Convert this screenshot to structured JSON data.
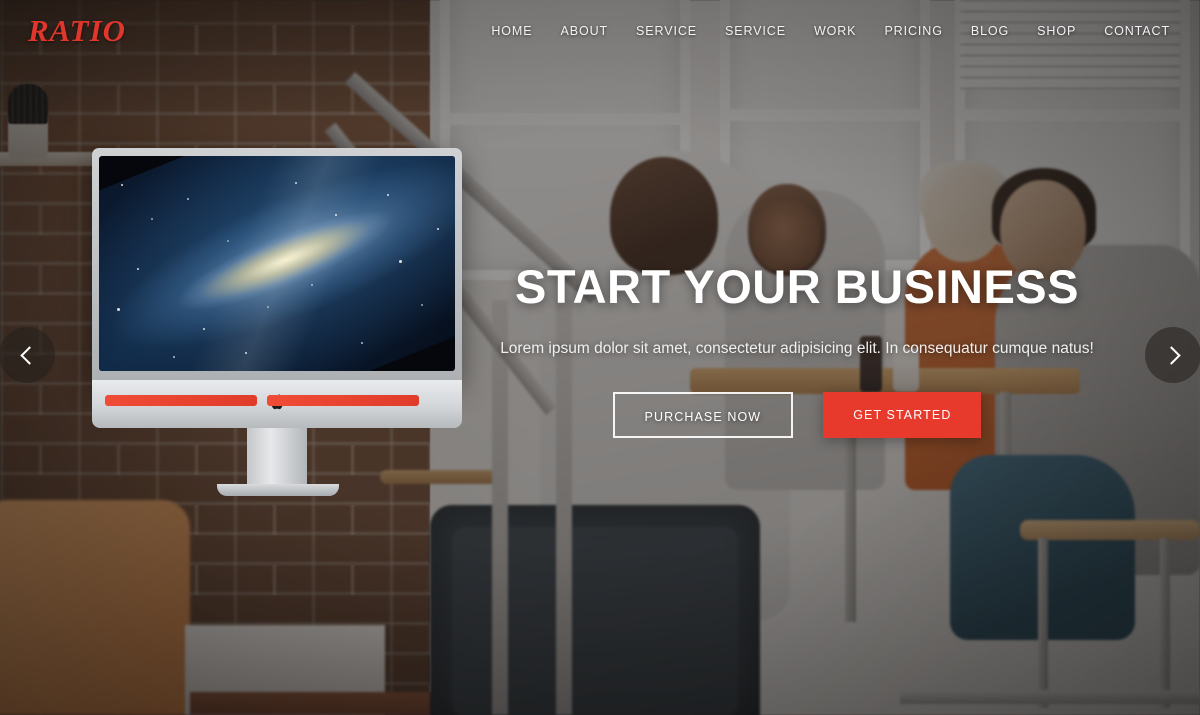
{
  "site": {
    "logo_text": "RATIO",
    "accent_color": "#e8392d",
    "logo_color": "#e0362b"
  },
  "header": {
    "nav": [
      {
        "label": "HOME",
        "name": "nav-item-home"
      },
      {
        "label": "ABOUT",
        "name": "nav-item-about"
      },
      {
        "label": "SERVICE",
        "name": "nav-item-service-1"
      },
      {
        "label": "SERVICE",
        "name": "nav-item-service-2"
      },
      {
        "label": "WORK",
        "name": "nav-item-work"
      },
      {
        "label": "PRICING",
        "name": "nav-item-pricing"
      },
      {
        "label": "BLOG",
        "name": "nav-item-blog"
      },
      {
        "label": "SHOP",
        "name": "nav-item-shop"
      },
      {
        "label": "CONTACT",
        "name": "nav-item-contact"
      }
    ]
  },
  "hero": {
    "heading": "START YOUR BUSINESS",
    "subheading": "Lorem ipsum dolor sit amet, consectetur adipisicing elit. In consequatur cumque natus!",
    "primary_button": "PURCHASE NOW",
    "secondary_button": "GET STARTED"
  },
  "carousel": {
    "prev_label": "‹",
    "next_label": "›"
  },
  "showcase": {
    "device": "iMac",
    "wallpaper": "galaxy",
    "brand_glyph": ""
  }
}
